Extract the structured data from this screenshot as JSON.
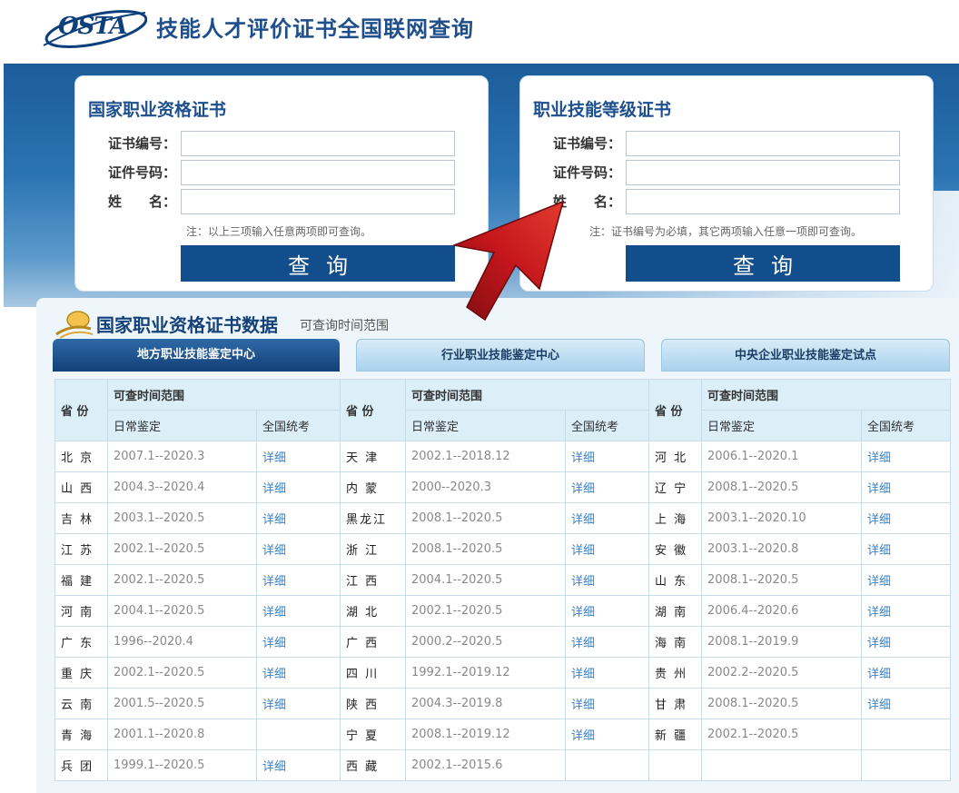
{
  "header": {
    "logo_text": "OSTA",
    "title": "技能人才评价证书全国联网查询"
  },
  "panels": [
    {
      "title": "国家职业资格证书",
      "fields": [
        {
          "label": "证书编号：",
          "value": ""
        },
        {
          "label": "证件号码：",
          "value": ""
        },
        {
          "label": "姓　　名：",
          "value": ""
        }
      ],
      "note": "注：以上三项输入任意两项即可查询。",
      "button": "查询"
    },
    {
      "title": "职业技能等级证书",
      "fields": [
        {
          "label": "证书编号：",
          "value": ""
        },
        {
          "label": "证件号码：",
          "value": ""
        },
        {
          "label": "姓　　名：",
          "value": ""
        }
      ],
      "note": "注：证书编号为必填，其它两项输入任意一项即可查询。",
      "button": "查询"
    }
  ],
  "section": {
    "title": "国家职业资格证书数据",
    "subtitle": "可查询时间范围",
    "tabs": [
      "地方职业技能鉴定中心",
      "行业职业技能鉴定中心",
      "中央企业职业技能鉴定试点"
    ]
  },
  "table": {
    "headers": {
      "province": "省 份",
      "range": "可查时间范围",
      "daily": "日常鉴定",
      "national": "全国统考"
    },
    "rows": [
      [
        [
          "北 京",
          "2007.1--2020.3",
          "详细"
        ],
        [
          "天 津",
          "2002.1--2018.12",
          "详细"
        ],
        [
          "河 北",
          "2006.1--2020.1",
          "详细"
        ]
      ],
      [
        [
          "山 西",
          "2004.3--2020.4",
          "详细"
        ],
        [
          "内 蒙",
          "2000--2020.3",
          "详细"
        ],
        [
          "辽 宁",
          "2008.1--2020.5",
          "详细"
        ]
      ],
      [
        [
          "吉 林",
          "2003.1--2020.5",
          "详细"
        ],
        [
          "黑龙江",
          "2008.1--2020.5",
          "详细"
        ],
        [
          "上 海",
          "2003.1--2020.10",
          "详细"
        ]
      ],
      [
        [
          "江 苏",
          "2002.1--2020.5",
          "详细"
        ],
        [
          "浙 江",
          "2008.1--2020.5",
          "详细"
        ],
        [
          "安 徽",
          "2003.1--2020.8",
          "详细"
        ]
      ],
      [
        [
          "福 建",
          "2002.1--2020.5",
          "详细"
        ],
        [
          "江 西",
          "2004.1--2020.5",
          "详细"
        ],
        [
          "山 东",
          "2008.1--2020.5",
          "详细"
        ]
      ],
      [
        [
          "河 南",
          "2004.1--2020.5",
          "详细"
        ],
        [
          "湖 北",
          "2002.1--2020.5",
          "详细"
        ],
        [
          "湖 南",
          "2006.4--2020.6",
          "详细"
        ]
      ],
      [
        [
          "广 东",
          "1996--2020.4",
          "详细"
        ],
        [
          "广 西",
          "2000.2--2020.5",
          "详细"
        ],
        [
          "海 南",
          "2008.1--2019.9",
          "详细"
        ]
      ],
      [
        [
          "重 庆",
          "2002.1--2020.5",
          "详细"
        ],
        [
          "四 川",
          "1992.1--2019.12",
          "详细"
        ],
        [
          "贵 州",
          "2002.2--2020.5",
          "详细"
        ]
      ],
      [
        [
          "云 南",
          "2001.5--2020.5",
          "详细"
        ],
        [
          "陕 西",
          "2004.3--2019.8",
          "详细"
        ],
        [
          "甘 肃",
          "2008.1--2020.5",
          "详细"
        ]
      ],
      [
        [
          "青 海",
          "2001.1--2020.8",
          ""
        ],
        [
          "宁 夏",
          "2008.1--2019.12",
          "详细"
        ],
        [
          "新 疆",
          "2002.1--2020.5",
          ""
        ]
      ],
      [
        [
          "兵 团",
          "1999.1--2020.5",
          "详细"
        ],
        [
          "西 藏",
          "2002.1--2015.6",
          ""
        ],
        [
          "",
          "",
          ""
        ]
      ]
    ]
  },
  "colors": {
    "brand_blue": "#134e8c",
    "link_blue": "#3a83c7",
    "arrow_red": "#c4161c"
  }
}
